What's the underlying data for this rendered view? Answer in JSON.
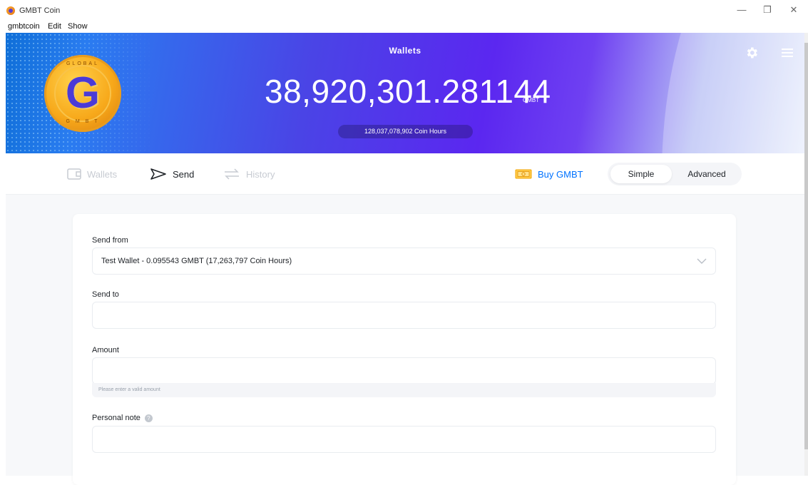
{
  "window": {
    "title": "GMBT Coin",
    "controls": {
      "minimize": "—",
      "restore": "❐",
      "close": "✕"
    }
  },
  "menubar": {
    "items": [
      "gmbtcoin",
      "Edit",
      "Show"
    ]
  },
  "header": {
    "title": "Wallets",
    "balance": "38,920,301.281144",
    "balance_unit": "GMBT",
    "coin_hours": "128,037,078,902 Coin Hours",
    "logo_text_top": "GLOBAL",
    "logo_text_bottom": "G M B T",
    "logo_letter": "G",
    "icons": [
      "settings-gear-icon",
      "menu-hamburger-icon"
    ]
  },
  "nav": {
    "wallets": "Wallets",
    "send": "Send",
    "history": "History",
    "buy": "Buy GMBT",
    "mode_simple": "Simple",
    "mode_advanced": "Advanced",
    "active": "Send",
    "active_mode": "Simple"
  },
  "form": {
    "send_from_label": "Send from",
    "send_from_value": "Test Wallet - 0.095543 GMBT (17,263,797 Coin Hours)",
    "send_to_label": "Send to",
    "send_to_value": "",
    "amount_label": "Amount",
    "amount_value": "",
    "amount_error": "Please enter a valid amount",
    "note_label": "Personal note",
    "note_value": ""
  },
  "colors": {
    "accent_blue": "#0072ff",
    "header_purple": "#5b27f0",
    "coin_gold": "#f7a81a"
  }
}
